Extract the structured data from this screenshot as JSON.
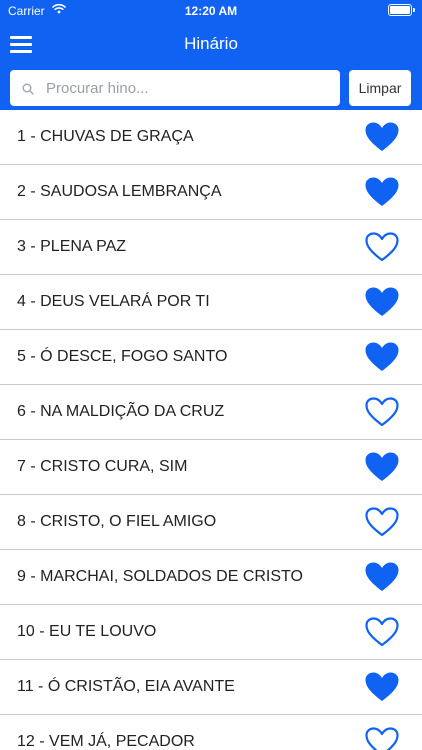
{
  "status_bar": {
    "carrier": "Carrier",
    "time": "12:20 AM"
  },
  "nav": {
    "title": "Hinário",
    "menu_icon": "hamburger-menu-icon"
  },
  "search": {
    "placeholder": "Procurar hino...",
    "value": "",
    "clear_label": "Limpar",
    "icon": "search-icon"
  },
  "colors": {
    "primary": "#0f62f2",
    "heart": "#0f62f2"
  },
  "hymns": [
    {
      "label": "1 - CHUVAS DE GRAÇA",
      "favorite": true
    },
    {
      "label": "2 - SAUDOSA LEMBRANÇA",
      "favorite": true
    },
    {
      "label": "3 - PLENA PAZ",
      "favorite": false
    },
    {
      "label": "4 - DEUS VELARÁ POR TI",
      "favorite": true
    },
    {
      "label": "5 - Ó DESCE, FOGO SANTO",
      "favorite": true
    },
    {
      "label": "6 - NA MALDIÇÃO DA CRUZ",
      "favorite": false
    },
    {
      "label": "7 - CRISTO CURA, SIM",
      "favorite": true
    },
    {
      "label": "8 - CRISTO, O FIEL AMIGO",
      "favorite": false
    },
    {
      "label": "9 - MARCHAI, SOLDADOS DE CRISTO",
      "favorite": true
    },
    {
      "label": "10 - EU TE LOUVO",
      "favorite": false
    },
    {
      "label": "11 - Ó CRISTÃO, EIA AVANTE",
      "favorite": true
    },
    {
      "label": "12 - VEM JÁ, PECADOR",
      "favorite": false
    }
  ]
}
